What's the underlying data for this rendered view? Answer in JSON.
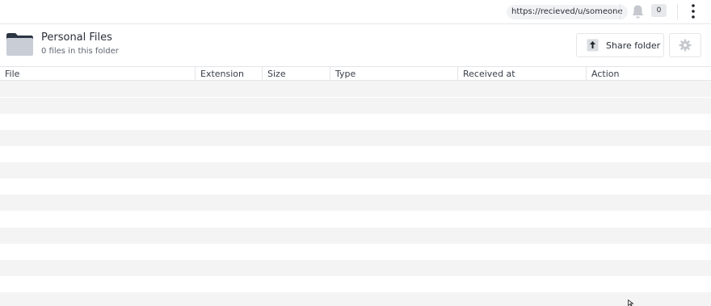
{
  "topbar": {
    "url": "https://recieved/u/someone",
    "bell_icon": "bell-icon",
    "notification_count": "0",
    "menu_icon": "kebab-menu-icon"
  },
  "folder": {
    "icon": "folder-icon",
    "title": "Personal Files",
    "subtitle": "0 files in this folder",
    "share_label": "Share folder",
    "share_icon": "upload-icon",
    "settings_icon": "gear-icon"
  },
  "table": {
    "columns": [
      "File",
      "Extension",
      "Size",
      "Type",
      "Received at",
      "Action"
    ],
    "rows": []
  },
  "colors": {
    "row_stripe": "#f4f4f5",
    "border": "#e3e5e8",
    "folder_front": "#c8cdd6",
    "folder_back": "#2a3442"
  }
}
